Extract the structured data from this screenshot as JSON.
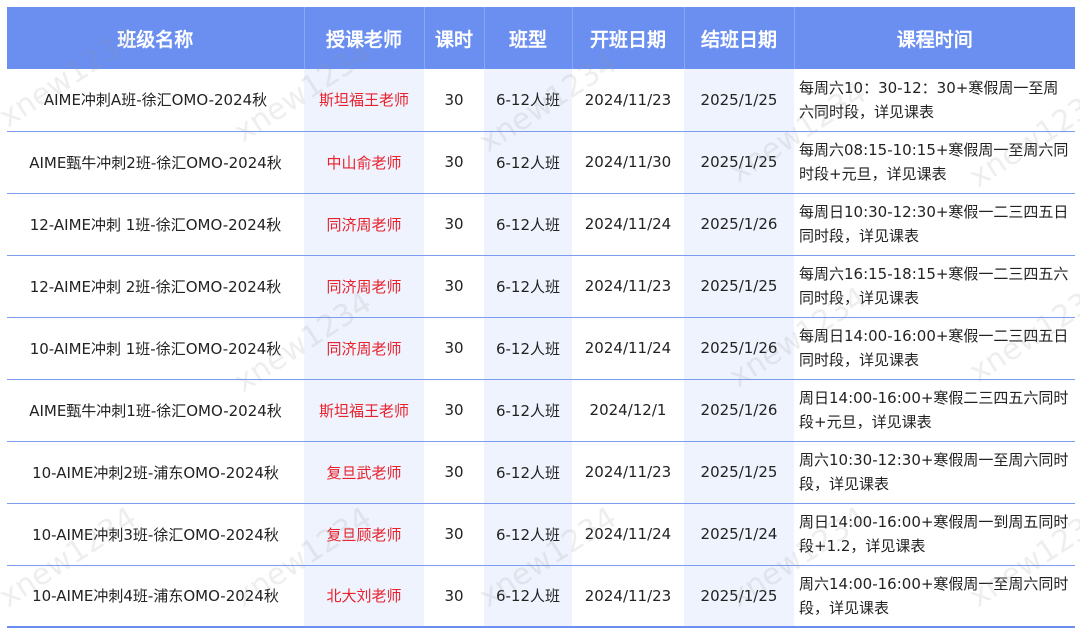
{
  "headers": [
    "班级名称",
    "授课老师",
    "课时",
    "班型",
    "开班日期",
    "结班日期",
    "课程时间"
  ],
  "rows": [
    [
      "AIME冲刺A班-徐汇OMO-2024秋",
      "斯坦福王老师",
      "30",
      "6-12人班",
      "2024/11/23",
      "2025/1/25",
      "每周六10：30-12：30+寒假周一至周六同时段，详见课表"
    ],
    [
      "AIME甄牛冲刺2班-徐汇OMO-2024秋",
      "中山俞老师",
      "30",
      "6-12人班",
      "2024/11/30",
      "2025/1/25",
      "每周六08:15-10:15+寒假周一至周六同时段+元旦，详见课表"
    ],
    [
      "12-AIME冲刺 1班-徐汇OMO-2024秋",
      "同济周老师",
      "30",
      "6-12人班",
      "2024/11/24",
      "2025/1/26",
      "每周日10:30-12:30+寒假一二三四五日同时段，详见课表"
    ],
    [
      "12-AIME冲刺 2班-徐汇OMO-2024秋",
      "同济周老师",
      "30",
      "6-12人班",
      "2024/11/23",
      "2025/1/25",
      "每周六16:15-18:15+寒假一二三四五六同时段，详见课表"
    ],
    [
      "10-AIME冲刺 1班-徐汇OMO-2024秋",
      "同济周老师",
      "30",
      "6-12人班",
      "2024/11/24",
      "2025/1/26",
      "每周日14:00-16:00+寒假一二三四五日同时段，详见课表"
    ],
    [
      "AIME甄牛冲刺1班-徐汇OMO-2024秋",
      "斯坦福王老师",
      "30",
      "6-12人班",
      "2024/12/1",
      "2025/1/26",
      "周日14:00-16:00+寒假二三四五六同时段+元旦，详见课表"
    ],
    [
      "10-AIME冲刺2班-浦东OMO-2024秋",
      "复旦武老师",
      "30",
      "6-12人班",
      "2024/11/23",
      "2025/1/25",
      "周六10:30-12:30+寒假周一至周六同时段，详见课表"
    ],
    [
      "10-AIME冲刺3班-徐汇OMO-2024秋",
      "复旦顾老师",
      "30",
      "6-12人班",
      "2024/11/24",
      "2025/1/24",
      "周日14:00-16:00+寒假周一到周五同时段+1.2，详见课表"
    ],
    [
      "10-AIME冲刺4班-浦东OMO-2024秋",
      "北大刘老师",
      "30",
      "6-12人班",
      "2024/11/23",
      "2025/1/25",
      "周六14:00-16:00+寒假周一至周六同时段，详见课表"
    ]
  ],
  "watermark": "xnew1234",
  "colors": {
    "header_bg": "#6b8ff0",
    "teacher_text": "#e8212c",
    "alt_col_bg": "#eef3fd"
  }
}
